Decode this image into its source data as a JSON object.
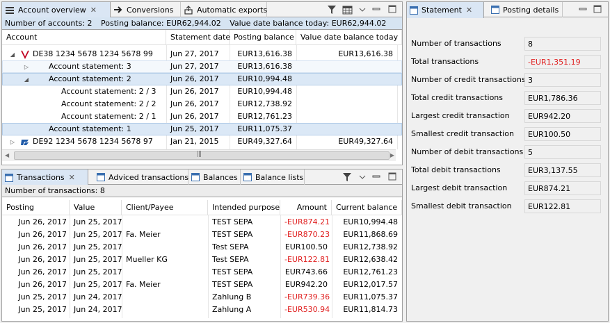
{
  "left_top": {
    "tabs": [
      {
        "label": "Account overview",
        "active": true
      },
      {
        "label": "Conversions",
        "active": false
      },
      {
        "label": "Automatic exports",
        "active": false
      }
    ],
    "info": {
      "accounts": "Number of accounts: 2",
      "posting": "Posting balance: EUR62,944.02",
      "value": "Value date balance today: EUR62,944.02"
    },
    "columns": [
      "Account",
      "Statement date",
      "Posting balance",
      "Value date balance today"
    ],
    "rows": [
      {
        "label": "DE38 1234 5678 1234 5678 99",
        "date": "Jun 27, 2017",
        "posting": "EUR13,616.38",
        "value": "EUR13,616.38"
      },
      {
        "label": "Account statement: 3",
        "date": "Jun 27, 2017",
        "posting": "EUR13,616.38",
        "value": ""
      },
      {
        "label": "Account statement: 2",
        "date": "Jun 26, 2017",
        "posting": "EUR10,994.48",
        "value": ""
      },
      {
        "label": "Account statement: 2 / 3",
        "date": "Jun 26, 2017",
        "posting": "EUR10,994.48",
        "value": ""
      },
      {
        "label": "Account statement: 2 / 2",
        "date": "Jun 26, 2017",
        "posting": "EUR12,738.92",
        "value": ""
      },
      {
        "label": "Account statement: 2 / 1",
        "date": "Jun 26, 2017",
        "posting": "EUR12,761.23",
        "value": ""
      },
      {
        "label": "Account statement: 1",
        "date": "Jun 25, 2017",
        "posting": "EUR11,075.37",
        "value": ""
      },
      {
        "label": "DE92 1234 5678 1234 5678 97",
        "date": "Jan 21, 2015",
        "posting": "EUR49,327.64",
        "value": "EUR49,327.64"
      }
    ]
  },
  "left_bottom": {
    "tabs": [
      {
        "label": "Transactions",
        "active": true
      },
      {
        "label": "Adviced transactions",
        "active": false
      },
      {
        "label": "Balances",
        "active": false
      },
      {
        "label": "Balance lists",
        "active": false
      }
    ],
    "info": "Number of transactions: 8",
    "columns": [
      "Posting",
      "Value",
      "Client/Payee",
      "Intended purpose",
      "Amount",
      "Current balance"
    ],
    "rows": [
      {
        "posting": "Jun 26, 2017",
        "value": "Jun 25, 2017",
        "payee": "",
        "purpose": "TEST SEPA",
        "amount": "-EUR874.21",
        "balance": "EUR10,994.48",
        "neg": true
      },
      {
        "posting": "Jun 26, 2017",
        "value": "Jun 25, 2017",
        "payee": "Fa. Meier",
        "purpose": "TEST SEPA",
        "amount": "-EUR870.23",
        "balance": "EUR11,868.69",
        "neg": true
      },
      {
        "posting": "Jun 26, 2017",
        "value": "Jun 25, 2017",
        "payee": "",
        "purpose": "Test SEPA",
        "amount": "EUR100.50",
        "balance": "EUR12,738.92",
        "neg": false
      },
      {
        "posting": "Jun 26, 2017",
        "value": "Jun 25, 2017",
        "payee": "Mueller KG",
        "purpose": "Test SEPA",
        "amount": "-EUR122.81",
        "balance": "EUR12,638.42",
        "neg": true
      },
      {
        "posting": "Jun 26, 2017",
        "value": "Jun 25, 2017",
        "payee": "",
        "purpose": "TEST SEPA",
        "amount": "EUR743.66",
        "balance": "EUR12,761.23",
        "neg": false
      },
      {
        "posting": "Jun 26, 2017",
        "value": "Jun 25, 2017",
        "payee": "Fa. Meier",
        "purpose": "TEST SEPA",
        "amount": "EUR942.20",
        "balance": "EUR12,017.57",
        "neg": false
      },
      {
        "posting": "Jun 25, 2017",
        "value": "Jun 24, 2017",
        "payee": "",
        "purpose": "Zahlung B",
        "amount": "-EUR739.36",
        "balance": "EUR11,075.37",
        "neg": true
      },
      {
        "posting": "Jun 25, 2017",
        "value": "Jun 24, 2017",
        "payee": "",
        "purpose": "Zahlung A",
        "amount": "-EUR530.94",
        "balance": "EUR11,814.73",
        "neg": true
      }
    ]
  },
  "right": {
    "tabs": [
      {
        "label": "Statement",
        "active": true
      },
      {
        "label": "Posting details",
        "active": false
      }
    ],
    "stats": [
      {
        "label": "Number of transactions",
        "value": "8",
        "neg": false
      },
      {
        "label": "Total transactions",
        "value": "-EUR1,351.19",
        "neg": true
      },
      {
        "label": "Number of credit transactions",
        "value": "3",
        "neg": false
      },
      {
        "label": "Total credit transactions",
        "value": "EUR1,786.36",
        "neg": false
      },
      {
        "label": "Largest credit transaction",
        "value": "EUR942.20",
        "neg": false
      },
      {
        "label": "Smallest credit transaction",
        "value": "EUR100.50",
        "neg": false
      },
      {
        "label": "Number of debit transactions",
        "value": "5",
        "neg": false
      },
      {
        "label": "Total debit transactions",
        "value": "EUR3,137.55",
        "neg": false
      },
      {
        "label": "Largest debit transaction",
        "value": "EUR874.21",
        "neg": false
      },
      {
        "label": "Smallest debit transaction",
        "value": "EUR122.81",
        "neg": false
      }
    ]
  },
  "colors": {
    "accent": "#dae6f4",
    "negative": "#e02020",
    "selection": "#dbe8f6"
  },
  "icons": [
    "list-icon",
    "arrow-right-icon",
    "export-icon",
    "filter-icon",
    "calendar-icon",
    "dropdown-icon",
    "minimize-icon",
    "maximize-icon",
    "bank-icon",
    "view-icon",
    "close-icon"
  ]
}
